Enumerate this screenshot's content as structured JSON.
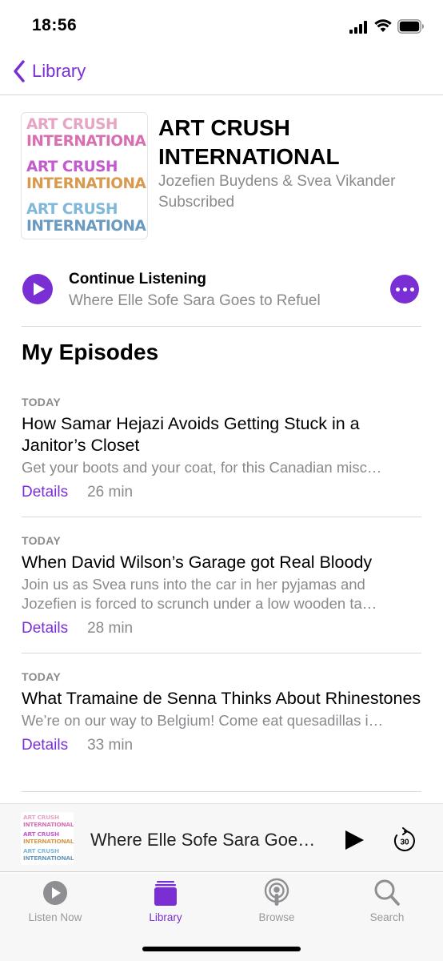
{
  "status_bar": {
    "time": "18:56"
  },
  "nav": {
    "back_label": "Library"
  },
  "podcast": {
    "artwork_lines": [
      "ART CRUSH",
      "INTERNATIONAL",
      "ART CRUSH",
      "INTERNATIONAL",
      "ART CRUSH",
      "INTERNATIONAL"
    ],
    "title": "ART CRUSH INTERNATIONAL",
    "author": "Jozefien Buydens & Svea Vikander",
    "status": "Subscribed"
  },
  "continue": {
    "title": "Continue Listening",
    "episode": "Where Elle Sofe Sara Goes to Refuel"
  },
  "section_title": "My Episodes",
  "episodes": [
    {
      "date": "TODAY",
      "title": "How Samar Hejazi Avoids Getting Stuck in a Janitor’s Closet",
      "description_lines": [
        "Get your boots and your coat, for this Canadian misc…"
      ],
      "details": "Details",
      "duration": "26 min"
    },
    {
      "date": "TODAY",
      "title": "When David Wilson’s Garage got Real Bloody",
      "description_lines": [
        "Join us as Svea runs into the car in her pyjamas and",
        "Jozefien is forced to scrunch under a low wooden ta…"
      ],
      "details": "Details",
      "duration": "28 min"
    },
    {
      "date": "TODAY",
      "title": "What Tramaine de Senna Thinks About Rhinestones",
      "description_lines": [
        "We’re on our way to Belgium! Come eat quesadillas i…"
      ],
      "details": "Details",
      "duration": "33 min"
    }
  ],
  "mini_player": {
    "title": "Where Elle Sofe Sara Goe…",
    "skip_seconds": "30"
  },
  "tabs": [
    {
      "label": "Listen Now",
      "icon": "play-circle-icon",
      "active": false
    },
    {
      "label": "Library",
      "icon": "library-icon",
      "active": true
    },
    {
      "label": "Browse",
      "icon": "podcast-icon",
      "active": false
    },
    {
      "label": "Search",
      "icon": "search-icon",
      "active": false
    }
  ],
  "colors": {
    "accent": "#7a2fd4",
    "secondary_text": "#8a8a8e",
    "tab_inactive": "#999999"
  }
}
